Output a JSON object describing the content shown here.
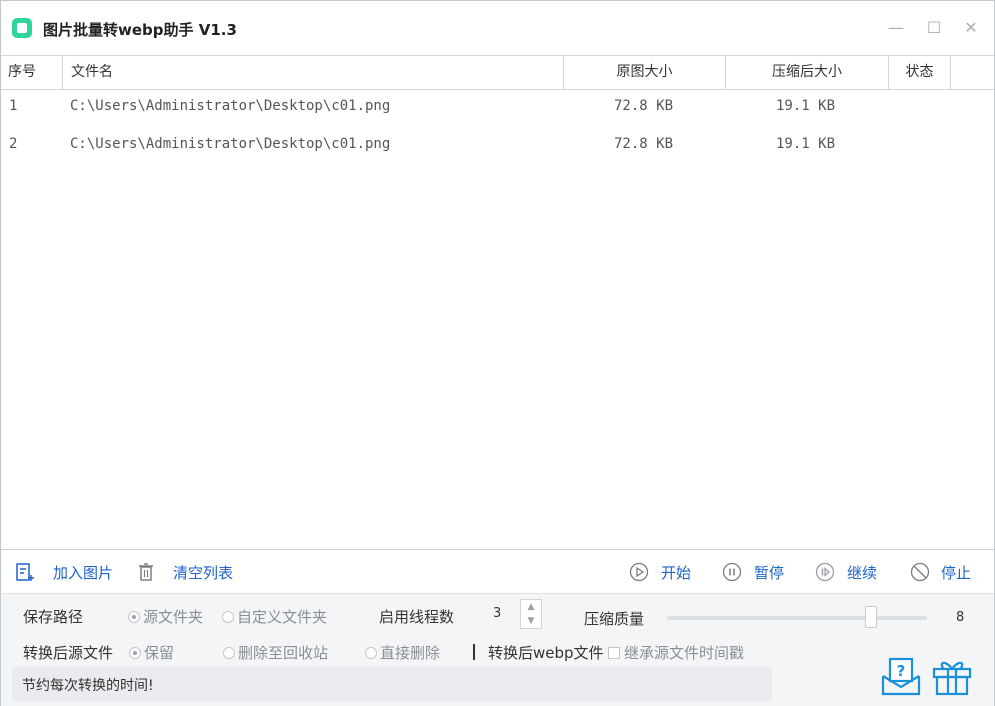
{
  "window": {
    "title": "图片批量转webp助手 V1.3",
    "icons": [
      "app-icon",
      "minimize-icon",
      "maximize-icon",
      "close-icon"
    ]
  },
  "table": {
    "columns": [
      "序号",
      "文件名",
      "原图大小",
      "压缩后大小",
      "状态"
    ],
    "rows": [
      {
        "index": "1",
        "file": "C:\\Users\\Administrator\\Desktop\\c01.png",
        "orig": "72.8 KB",
        "comp": "19.1 KB",
        "status": ""
      },
      {
        "index": "2",
        "file": "C:\\Users\\Administrator\\Desktop\\c01.png",
        "orig": "72.8 KB",
        "comp": "19.1 KB",
        "status": ""
      }
    ]
  },
  "toolbar": {
    "add": "加入图片",
    "clear": "清空列表",
    "start": "开始",
    "pause": "暂停",
    "resume": "继续",
    "stop": "停止"
  },
  "settings": {
    "save_path_label": "保存路径",
    "save_path_options": [
      "源文件夹",
      "自定义文件夹"
    ],
    "threads_label": "启用线程数",
    "threads_value": "3",
    "quality_label": "压缩质量",
    "quality_value": "8",
    "source_after_label": "转换后源文件",
    "source_after_options": [
      "保留",
      "删除至回收站",
      "直接删除"
    ],
    "webp_after_label": "转换后webp文件",
    "inherit_time_label": "继承源文件时间戳"
  },
  "status": {
    "message": "节约每次转换的时间!"
  },
  "colors": {
    "accent": "#1e63c9",
    "app_icon": "#2fd49b",
    "bottom_icons": "#1c8fd9"
  }
}
